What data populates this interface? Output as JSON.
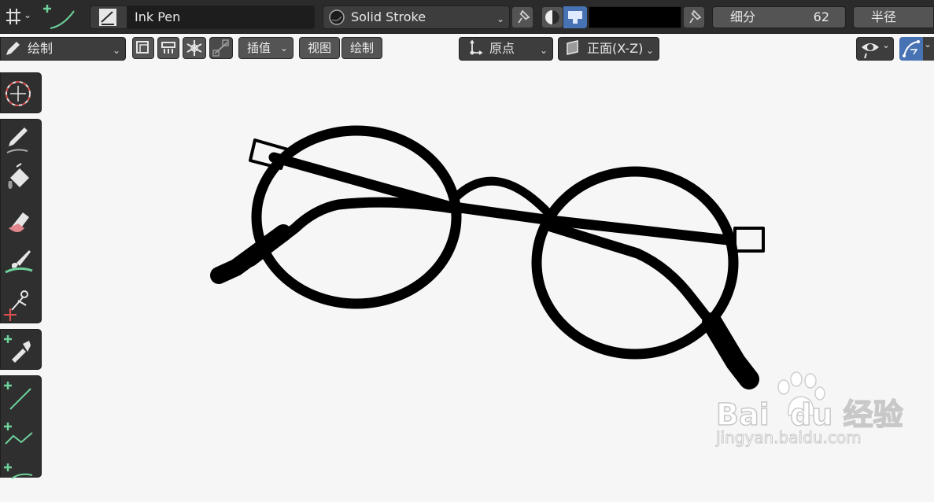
{
  "header": {
    "brush_name": "Ink Pen",
    "material_name": "Solid Stroke",
    "subdivide_label": "细分",
    "subdivide_value": "62",
    "radius_label": "半径"
  },
  "toolbar": {
    "mode_label": "绘制",
    "interpolate_label": "插值",
    "view_label": "视图",
    "draw_label": "绘制",
    "origin_label": "原点",
    "plane_label": "正面(X-Z)"
  },
  "tools": [
    {
      "name": "cursor"
    },
    {
      "name": "draw"
    },
    {
      "name": "fill"
    },
    {
      "name": "erase"
    },
    {
      "name": "tint"
    },
    {
      "name": "cutter"
    },
    {
      "name": "eyedropper"
    },
    {
      "name": "line"
    },
    {
      "name": "polyline"
    },
    {
      "name": "arc"
    }
  ],
  "watermark": {
    "logo_text": "Bai  du 经验",
    "url": "jingyan.baidu.com"
  },
  "colors": {
    "stroke": "#000000",
    "canvas": "#f6f6f6",
    "accent": "#4772b3",
    "green": "#6fd19c"
  }
}
